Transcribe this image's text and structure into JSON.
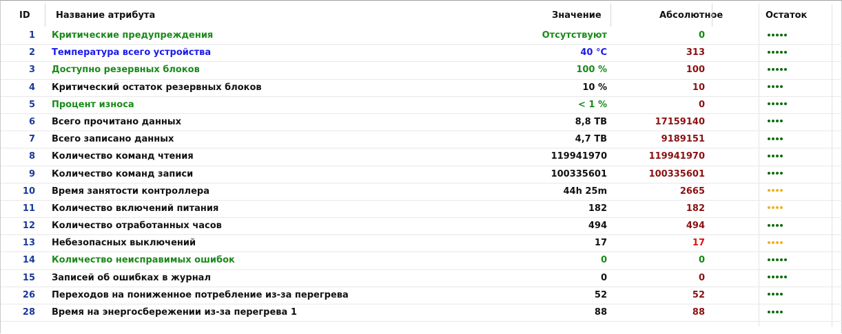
{
  "header": {
    "id": "ID",
    "name": "Название атрибута",
    "value": "Значение",
    "absolute": "Абсолютное",
    "remaining": "Остаток"
  },
  "colors": {
    "green": "#1a8a1a",
    "blue": "#1a1aee",
    "black": "#111111",
    "dark_red": "#8b1010",
    "red": "#e01010",
    "dot_green": "#0c6b0c",
    "dot_yellow": "#f0b020"
  },
  "rows": [
    {
      "id": "1",
      "name": "Критические предупреждения",
      "value": "Отсутствуют",
      "absolute": "0",
      "dots": 5,
      "dot_color": "green",
      "name_color": "green",
      "value_color": "green",
      "abs_color": "darkgreen"
    },
    {
      "id": "2",
      "name": "Температура всего устройства",
      "value": "40 °C",
      "absolute": "313",
      "dots": 5,
      "dot_color": "green",
      "name_color": "blue",
      "value_color": "blue",
      "abs_color": "darkred"
    },
    {
      "id": "3",
      "name": "Доступно резервных блоков",
      "value": "100 %",
      "absolute": "100",
      "dots": 5,
      "dot_color": "green",
      "name_color": "green",
      "value_color": "green",
      "abs_color": "darkred"
    },
    {
      "id": "4",
      "name": "Критический остаток резервных блоков",
      "value": "10 %",
      "absolute": "10",
      "dots": 4,
      "dot_color": "green",
      "name_color": "black",
      "value_color": "black",
      "abs_color": "darkred"
    },
    {
      "id": "5",
      "name": "Процент износа",
      "value": "< 1 %",
      "absolute": "0",
      "dots": 5,
      "dot_color": "green",
      "name_color": "green",
      "value_color": "green",
      "abs_color": "darkred"
    },
    {
      "id": "6",
      "name": "Всего прочитано данных",
      "value": "8,8 TB",
      "absolute": "17159140",
      "dots": 4,
      "dot_color": "green",
      "name_color": "black",
      "value_color": "black",
      "abs_color": "darkred"
    },
    {
      "id": "7",
      "name": "Всего записано данных",
      "value": "4,7 TB",
      "absolute": "9189151",
      "dots": 4,
      "dot_color": "green",
      "name_color": "black",
      "value_color": "black",
      "abs_color": "darkred"
    },
    {
      "id": "8",
      "name": "Количество команд чтения",
      "value": "119941970",
      "absolute": "119941970",
      "dots": 4,
      "dot_color": "green",
      "name_color": "black",
      "value_color": "black",
      "abs_color": "darkred"
    },
    {
      "id": "9",
      "name": "Количество команд записи",
      "value": "100335601",
      "absolute": "100335601",
      "dots": 4,
      "dot_color": "green",
      "name_color": "black",
      "value_color": "black",
      "abs_color": "darkred"
    },
    {
      "id": "10",
      "name": "Время занятости контроллера",
      "value": "44h 25m",
      "absolute": "2665",
      "dots": 4,
      "dot_color": "yellow",
      "name_color": "black",
      "value_color": "black",
      "abs_color": "darkred"
    },
    {
      "id": "11",
      "name": "Количество включений питания",
      "value": "182",
      "absolute": "182",
      "dots": 4,
      "dot_color": "yellow",
      "name_color": "black",
      "value_color": "black",
      "abs_color": "darkred"
    },
    {
      "id": "12",
      "name": "Количество отработанных часов",
      "value": "494",
      "absolute": "494",
      "dots": 4,
      "dot_color": "green",
      "name_color": "black",
      "value_color": "black",
      "abs_color": "darkred"
    },
    {
      "id": "13",
      "name": "Небезопасных выключений",
      "value": "17",
      "absolute": "17",
      "dots": 4,
      "dot_color": "yellow",
      "name_color": "black",
      "value_color": "black",
      "abs_color": "red"
    },
    {
      "id": "14",
      "name": "Количество неисправимых ошибок",
      "value": "0",
      "absolute": "0",
      "dots": 5,
      "dot_color": "green",
      "name_color": "green",
      "value_color": "green",
      "abs_color": "darkgreen"
    },
    {
      "id": "15",
      "name": "Записей об ошибках в журнал",
      "value": "0",
      "absolute": "0",
      "dots": 5,
      "dot_color": "green",
      "name_color": "black",
      "value_color": "black",
      "abs_color": "darkred"
    },
    {
      "id": "26",
      "name": "Переходов на пониженное потребление из-за перегрева",
      "value": "52",
      "absolute": "52",
      "dots": 4,
      "dot_color": "green",
      "name_color": "black",
      "value_color": "black",
      "abs_color": "darkred"
    },
    {
      "id": "28",
      "name": "Время на энергосбережении из-за перегрева 1",
      "value": "88",
      "absolute": "88",
      "dots": 4,
      "dot_color": "green",
      "name_color": "black",
      "value_color": "black",
      "abs_color": "darkred"
    }
  ]
}
